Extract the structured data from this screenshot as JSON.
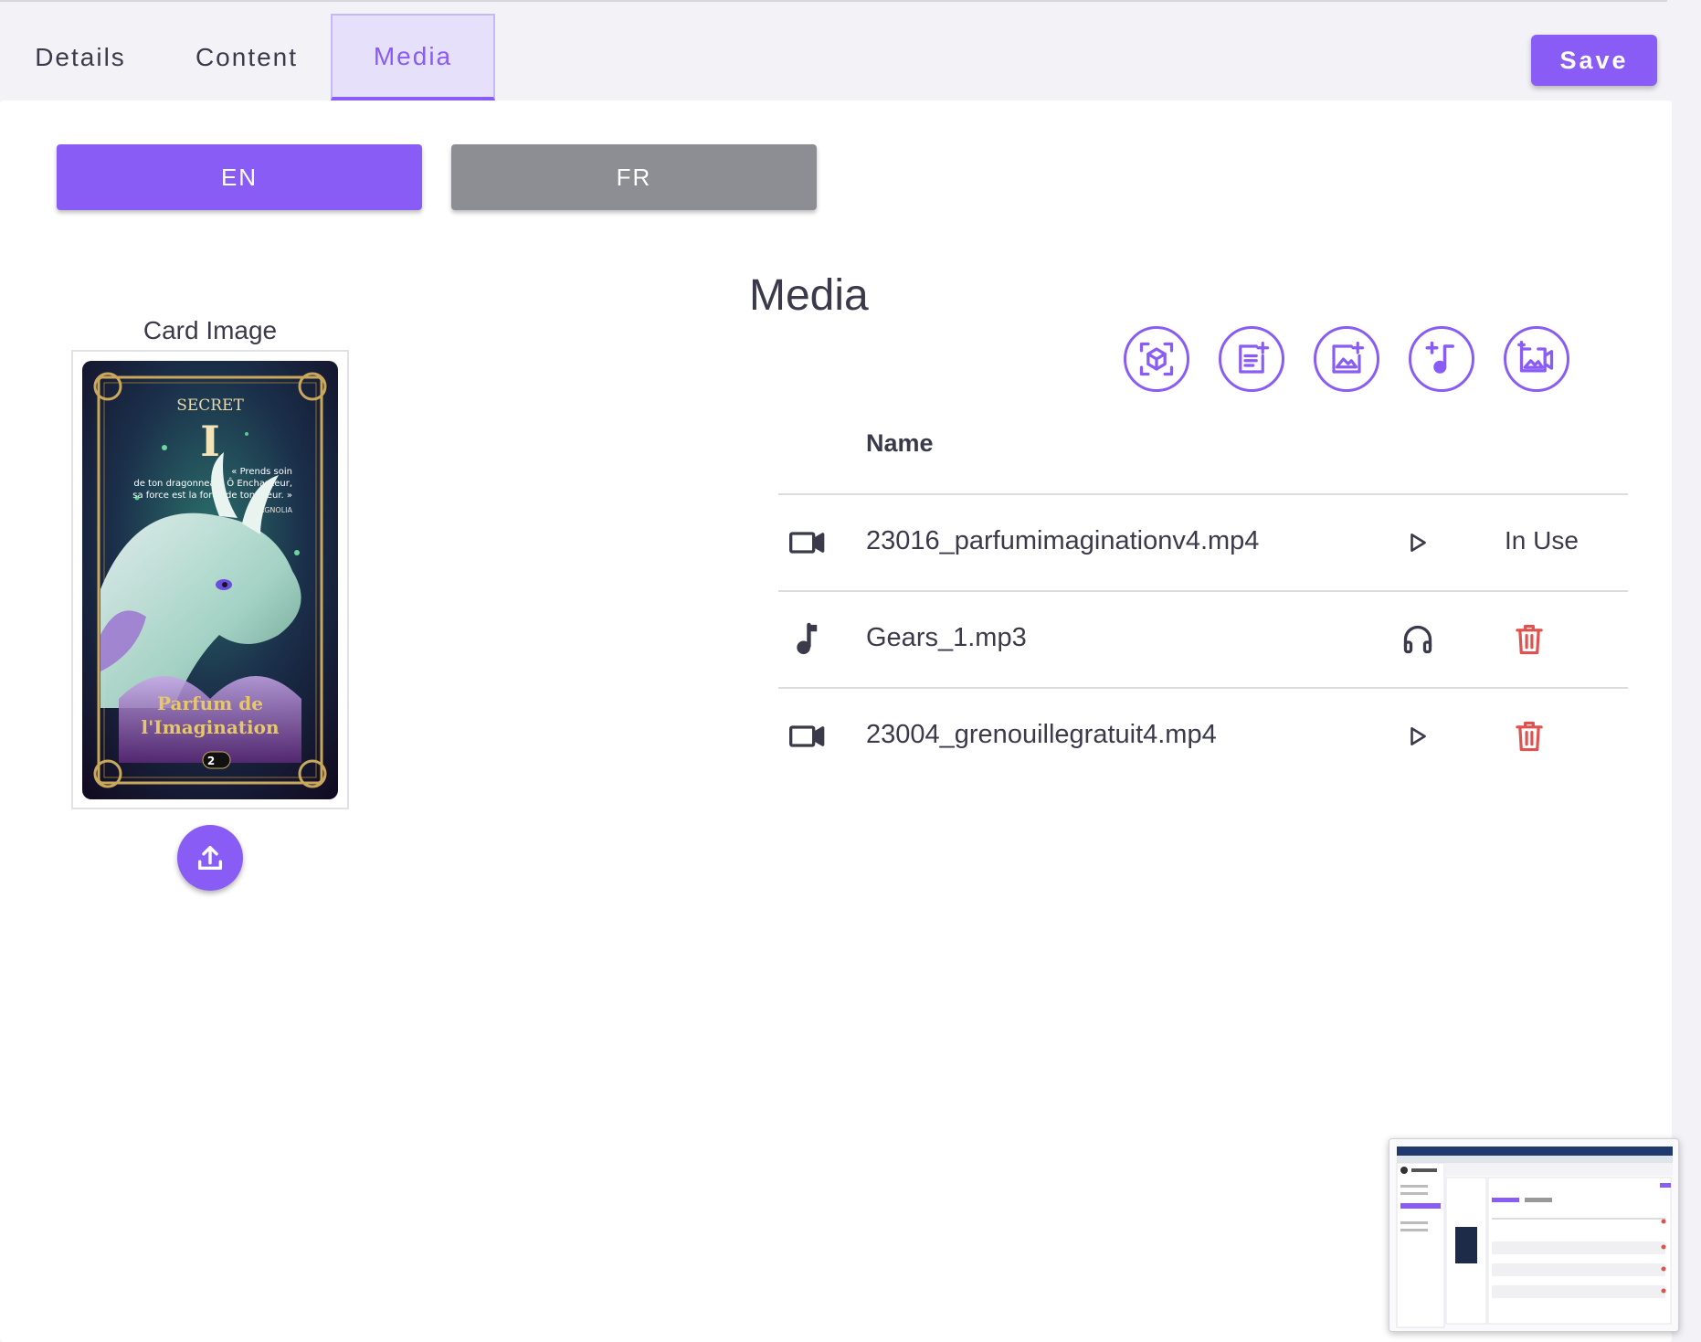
{
  "tabs": [
    {
      "label": "Details"
    },
    {
      "label": "Content"
    },
    {
      "label": "Media",
      "active": true
    }
  ],
  "toolbar": {
    "save_label": "Save"
  },
  "languages": [
    {
      "label": "EN",
      "selected": true
    },
    {
      "label": "FR",
      "selected": false
    }
  ],
  "card": {
    "label": "Card Image",
    "art_text": {
      "secret": "SECRET",
      "numeral": "I",
      "quote_line1": "« Prends soin",
      "quote_line2": "de ton dragonneau, Ô Enchanteur,",
      "quote_line3": "sa force est la force de ton cœur. »",
      "author": "MAGNOLIA",
      "title_line1": "Parfum de",
      "title_line2": "l'Imagination",
      "badge": "2"
    },
    "upload_icon": "upload-icon"
  },
  "media": {
    "title": "Media",
    "add_buttons": [
      {
        "icon": "ar-cube-icon"
      },
      {
        "icon": "add-text-icon"
      },
      {
        "icon": "add-image-icon"
      },
      {
        "icon": "add-audio-icon"
      },
      {
        "icon": "add-video-icon"
      }
    ],
    "column_name": "Name",
    "rows": [
      {
        "type": "video",
        "name": "23016_parfumimaginationv4.mp4",
        "preview": "play-icon",
        "status": "In Use"
      },
      {
        "type": "audio",
        "name": "Gears_1.mp3",
        "preview": "headphones-icon",
        "status": "delete"
      },
      {
        "type": "video",
        "name": "23004_grenouillegratuit4.mp4",
        "preview": "play-icon",
        "status": "delete"
      }
    ]
  },
  "colors": {
    "accent": "#8a5cf6",
    "inactive": "#8d8e93",
    "danger": "#e0524f",
    "text": "#3b3a4a"
  }
}
